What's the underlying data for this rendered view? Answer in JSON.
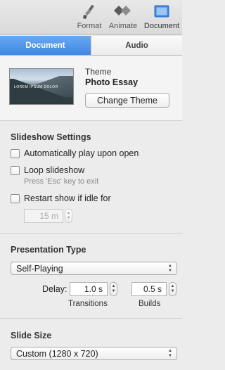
{
  "toolbar": {
    "format_label": "Format",
    "animate_label": "Animate",
    "document_label": "Document"
  },
  "tabs": [
    {
      "label": "Document",
      "selected": true
    },
    {
      "label": "Audio",
      "selected": false
    }
  ],
  "theme": {
    "heading": "Theme",
    "name": "Photo Essay",
    "thumbnail_caption": "LOREM IPSUM DOLOR",
    "change_button": "Change Theme"
  },
  "slideshow": {
    "title": "Slideshow Settings",
    "autoplay_label": "Automatically play upon open",
    "loop_label": "Loop slideshow",
    "loop_hint": "Press 'Esc' key to exit",
    "restart_label": "Restart show if idle for",
    "idle_value": "15 m"
  },
  "presentation": {
    "title": "Presentation Type",
    "type_value": "Self-Playing",
    "delay_label": "Delay:",
    "transitions_value": "1.0 s",
    "builds_value": "0.5 s",
    "transitions_label": "Transitions",
    "builds_label": "Builds"
  },
  "slide_size": {
    "title": "Slide Size",
    "value": "Custom (1280 x 720)"
  },
  "colors": {
    "accent": "#4a90e8",
    "panel": "#ececec"
  }
}
